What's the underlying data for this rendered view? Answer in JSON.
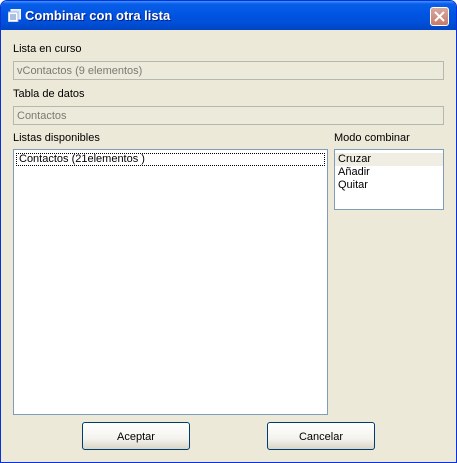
{
  "window": {
    "title": "Combinar con otra lista"
  },
  "current_list": {
    "label": "Lista en curso",
    "value": "vContactos (9 elementos)"
  },
  "data_table": {
    "label": "Tabla de datos",
    "value": "Contactos"
  },
  "available_lists": {
    "label": "Listas disponibles",
    "items": [
      "Contactos (21elementos )"
    ]
  },
  "combine_mode": {
    "label": "Modo combinar",
    "options": [
      "Cruzar",
      "Añadir",
      "Quitar"
    ],
    "selected": "Cruzar"
  },
  "buttons": {
    "accept": "Aceptar",
    "cancel": "Cancelar"
  },
  "colors": {
    "titlebar": "#0054e3",
    "window_bg": "#ece9d8",
    "close_button": "#c77b6a"
  }
}
